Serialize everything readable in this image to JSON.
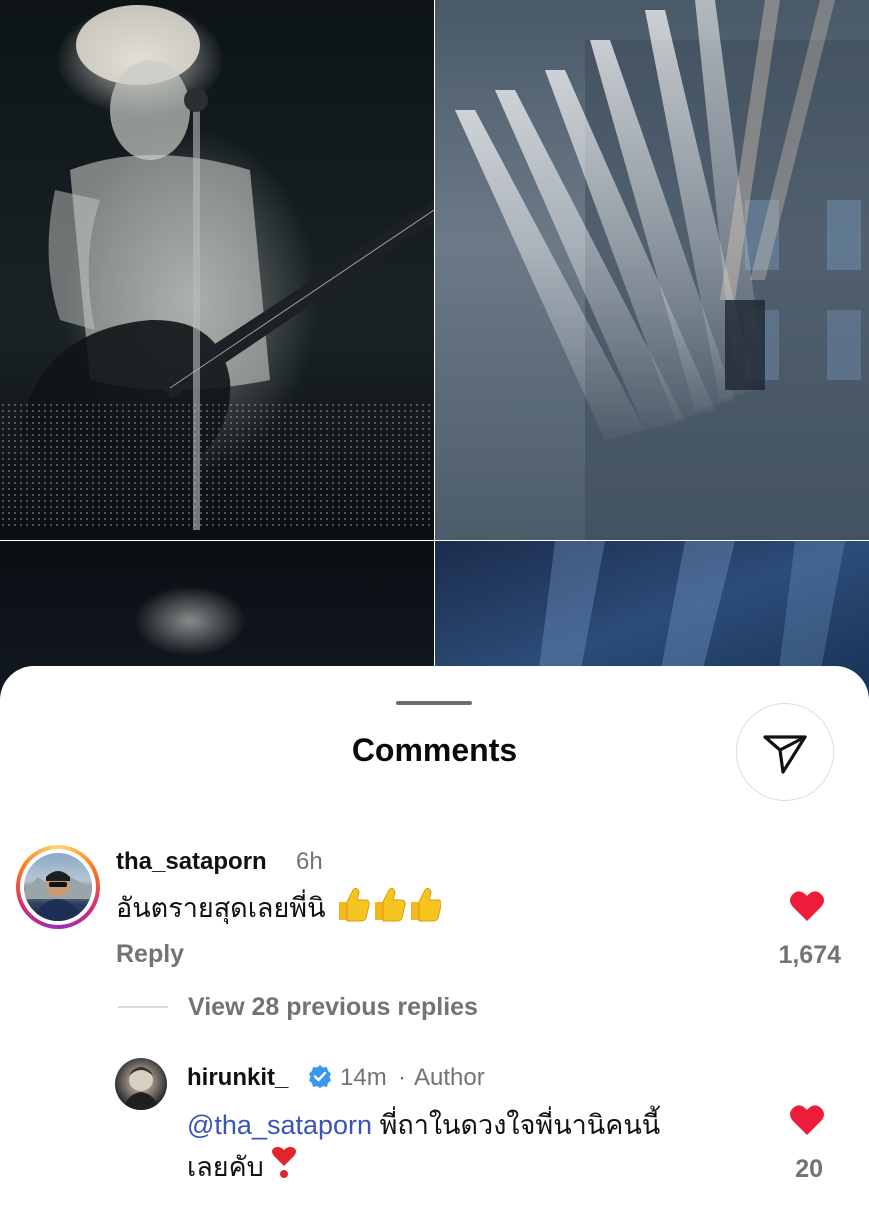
{
  "sheet": {
    "title": "Comments"
  },
  "comments": [
    {
      "username": "tha_sataporn",
      "time": "6h",
      "text": "อันตรายสุดเลยพี่นิ",
      "emoji": "thumbs-up ×3",
      "reply_label": "Reply",
      "like_count": "1,674",
      "view_replies": "View 28 previous replies"
    },
    {
      "username": "hirunkit_",
      "time": "14m",
      "separator": "·",
      "badge": "Author",
      "mention": "@tha_sataporn",
      "text_line1": "พี่ถาในดวงใจพี่นานิคนนี้",
      "text_line2": "เลยคับ",
      "emoji": "heart-exclamation",
      "like_count": "20"
    }
  ],
  "icons": {
    "share": "send-icon",
    "like": "heart-icon",
    "verified": "verified-badge-icon"
  },
  "colors": {
    "heart": "#ed1c3a",
    "mention": "#3a55b6",
    "muted": "#737373",
    "verified": "#3897f0"
  }
}
